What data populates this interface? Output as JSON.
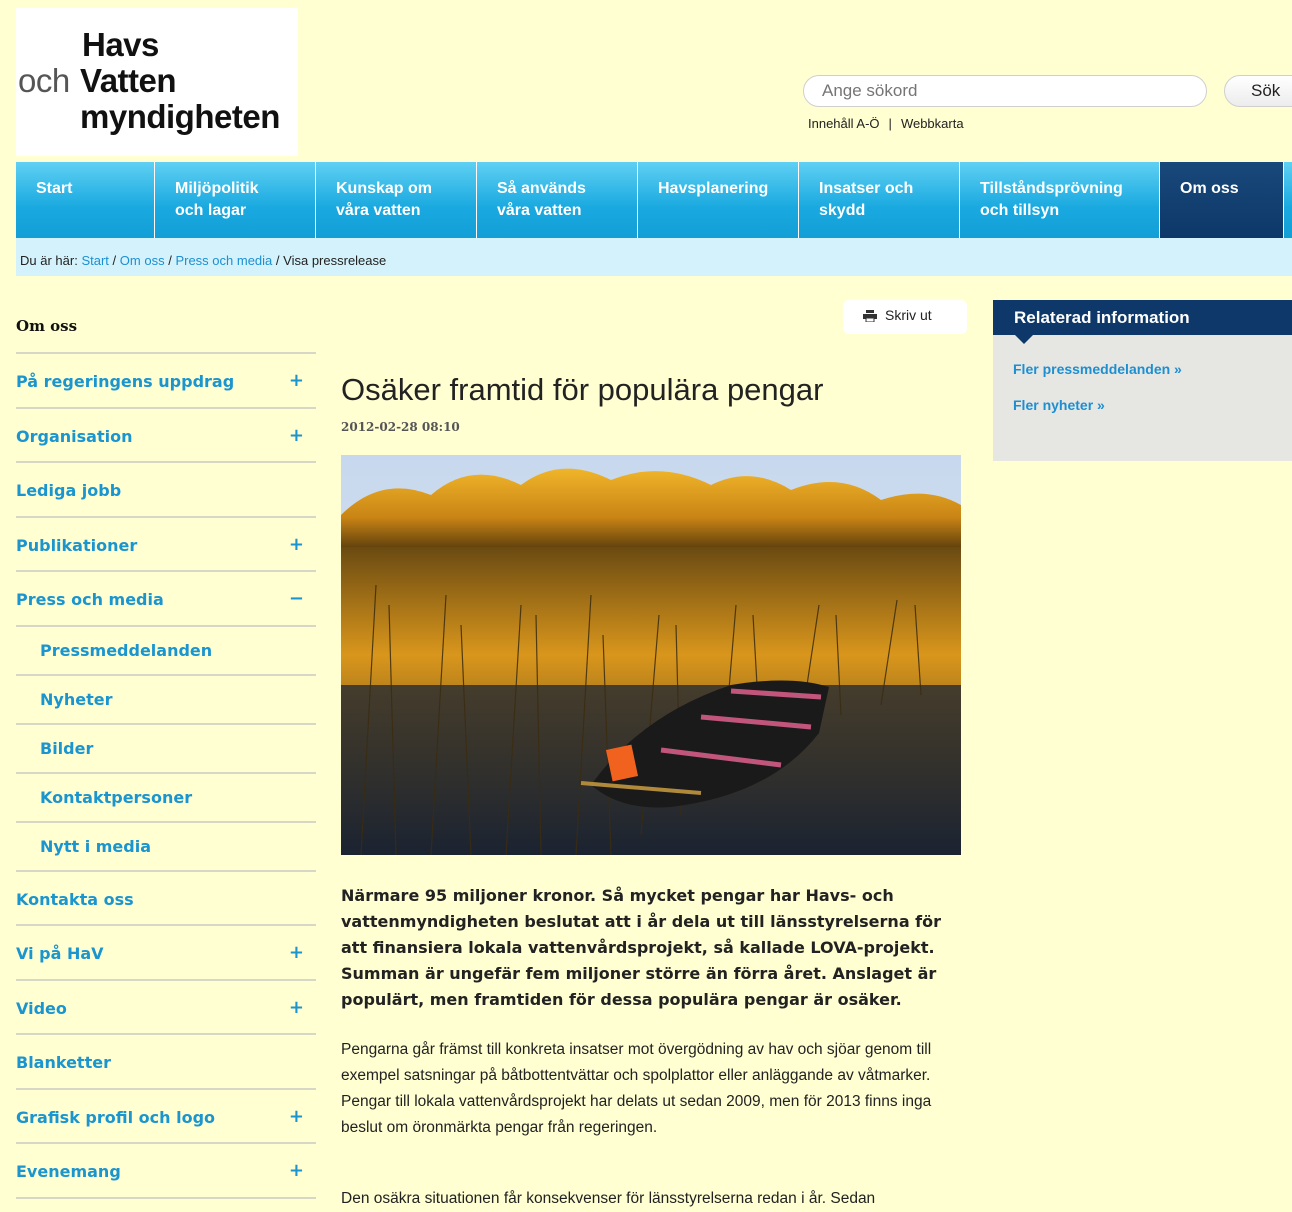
{
  "logo": {
    "line1": "Havs",
    "line2a": "och",
    "line2b": "Vatten",
    "line3": "myndigheten"
  },
  "search": {
    "placeholder": "Ange sökord",
    "button": "Sök"
  },
  "util": {
    "link1": "Innehåll A-Ö",
    "separator": "|",
    "link2": "Webbkarta"
  },
  "topnav": [
    "Start",
    "Miljöpolitik\noch lagar",
    "Kunskap om\nvåra vatten",
    "Så används\nvåra vatten",
    "Havsplanering",
    "Insatser och\nskydd",
    "Tillståndsprövning\noch tillsyn",
    "Om oss"
  ],
  "breadcrumb": {
    "prefix": "Du är här:",
    "c1": "Start",
    "c2": "Om oss",
    "c3": "Press och media",
    "current": "Visa pressrelease",
    "sep": "/"
  },
  "sidenav": {
    "heading": "Om oss",
    "items": [
      {
        "label": "På regeringens uppdrag",
        "toggle": "+"
      },
      {
        "label": "Organisation",
        "toggle": "+"
      },
      {
        "label": "Lediga jobb",
        "toggle": ""
      },
      {
        "label": "Publikationer",
        "toggle": "+"
      },
      {
        "label": "Press och media",
        "toggle": "−"
      },
      {
        "label": "Pressmeddelanden",
        "toggle": ""
      },
      {
        "label": "Nyheter",
        "toggle": ""
      },
      {
        "label": "Bilder",
        "toggle": ""
      },
      {
        "label": "Kontaktpersoner",
        "toggle": ""
      },
      {
        "label": "Nytt i media",
        "toggle": ""
      },
      {
        "label": "Kontakta oss",
        "toggle": ""
      },
      {
        "label": "Vi på HaV",
        "toggle": "+"
      },
      {
        "label": "Video",
        "toggle": "+"
      },
      {
        "label": "Blanketter",
        "toggle": ""
      },
      {
        "label": "Grafisk profil och logo",
        "toggle": "+"
      },
      {
        "label": "Evenemang",
        "toggle": "+"
      }
    ]
  },
  "print": {
    "label": "Skriv ut"
  },
  "article": {
    "title": "Osäker framtid för populära pengar",
    "date": "2012-02-28 08:10",
    "lead": "Närmare 95 miljoner kronor. Så mycket pengar har Havs- och vattenmyndigheten beslutat att i år dela ut till länsstyrelserna för att finansiera lokala vattenvårdsprojekt, så kallade LOVA-projekt. Summan är ungefär fem miljoner större än förra året. Anslaget är populärt, men framtiden för dessa populära pengar är osäker.",
    "p1": "Pengarna går främst till konkreta insatser mot övergödning av hav och sjöar genom till exempel satsningar på båtbottentvättar och spolplattor eller anläggande av våtmarker. Pengar till lokala vattenvårdsprojekt har delats ut sedan 2009, men för 2013 finns inga beslut om öronmärkta pengar från regeringen.",
    "p2": "Den osäkra situationen får konsekvenser för länsstyrelserna redan i år. Sedan"
  },
  "related": {
    "heading": "Relaterad information",
    "link1": "Fler pressmeddelanden »",
    "link2": "Fler nyheter »"
  },
  "colors": {
    "nav": "#19a9e0",
    "nav_active": "#0d3869",
    "link": "#1d8fd1",
    "background": "#ffffd2"
  }
}
